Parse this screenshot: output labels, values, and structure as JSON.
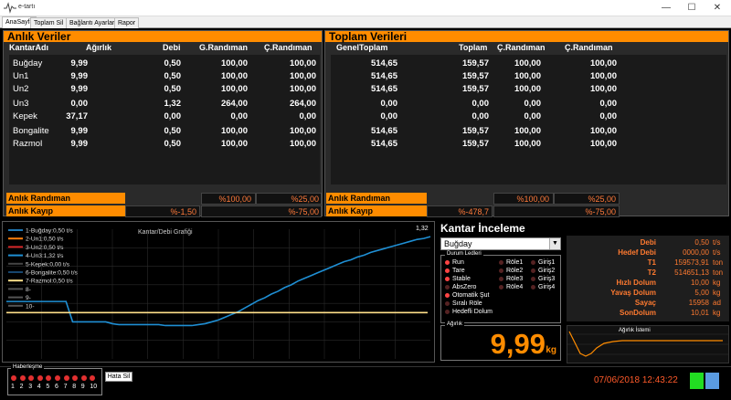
{
  "window": {
    "title": "e-tartı",
    "minimize": "—",
    "maximize": "☐",
    "close": "✕"
  },
  "tabs": [
    "AnaSayfa",
    "Toplam Sil",
    "Bağlantı Ayarları",
    "Rapor"
  ],
  "anlik": {
    "title": "Anlık Veriler",
    "headers": [
      "KantarAdı",
      "Ağırlık",
      "Debi",
      "G.Randıman",
      "Ç.Randıman"
    ],
    "rows": [
      [
        "Buğday",
        "9,99",
        "0,50",
        "100,00",
        "100,00"
      ],
      [
        "Un1",
        "9,99",
        "0,50",
        "100,00",
        "100,00"
      ],
      [
        "Un2",
        "9,99",
        "0,50",
        "100,00",
        "100,00"
      ],
      [
        "Un3",
        "0,00",
        "1,32",
        "264,00",
        "264,00"
      ],
      [
        "Kepek",
        "37,17",
        "0,00",
        "0,00",
        "0,00"
      ],
      [
        "Bongalite",
        "9,99",
        "0,50",
        "100,00",
        "100,00"
      ],
      [
        "Razmol",
        "9,99",
        "0,50",
        "100,00",
        "100,00"
      ]
    ],
    "randiman_label": "Anlık Randıman",
    "randiman_g": "%100,00",
    "randiman_c": "%25,00",
    "kayip_label": "Anlık Kayıp",
    "kayip_a": "%-1,50",
    "kayip_c": "%-75,00"
  },
  "toplam": {
    "title": "Toplam Verileri",
    "headers": [
      "GenelToplam",
      "Toplam",
      "Ç.Randıman",
      "Ç.Randıman"
    ],
    "rows": [
      [
        "514,65",
        "159,57",
        "100,00",
        "100,00"
      ],
      [
        "514,65",
        "159,57",
        "100,00",
        "100,00"
      ],
      [
        "514,65",
        "159,57",
        "100,00",
        "100,00"
      ],
      [
        "0,00",
        "0,00",
        "0,00",
        "0,00"
      ],
      [
        "0,00",
        "0,00",
        "0,00",
        "0,00"
      ],
      [
        "514,65",
        "159,57",
        "100,00",
        "100,00"
      ],
      [
        "514,65",
        "159,57",
        "100,00",
        "100,00"
      ]
    ],
    "randiman_label": "Anlık Randıman",
    "randiman_g": "%100,00",
    "randiman_c": "%25,00",
    "kayip_label": "Anlık Kayıp",
    "kayip_a": "%-478,7",
    "kayip_c": "%-75,00"
  },
  "chart_data": {
    "type": "line",
    "title": "Kantar/Debi Grafiği",
    "end_label": "1,32",
    "legend_placement": "top-left",
    "grid": true,
    "series": [
      {
        "name": "1-Buğday:0,50 t/s",
        "color": "#1f77b4"
      },
      {
        "name": "2-Un1:0,50 t/s",
        "color": "#ff7f0e"
      },
      {
        "name": "3-Un2:0,50 t/s",
        "color": "#d62728"
      },
      {
        "name": "4-Un3:1,32 t/s",
        "color": "#1f8fd4",
        "values": [
          0.62,
          0.62,
          0.62,
          0.62,
          0.62,
          0.62,
          0.62,
          0.62,
          0.62,
          0.62,
          0.4,
          0.4,
          0.4,
          0.4,
          0.4,
          0.4,
          0.38,
          0.37,
          0.37,
          0.37,
          0.37,
          0.37,
          0.37,
          0.37,
          0.36,
          0.36,
          0.36,
          0.36,
          0.36,
          0.37,
          0.38,
          0.4,
          0.42,
          0.45,
          0.48,
          0.51,
          0.55,
          0.59,
          0.63,
          0.66,
          0.7,
          0.73,
          0.77,
          0.8,
          0.84,
          0.87,
          0.9,
          0.93,
          0.96,
          0.99,
          1.02,
          1.05,
          1.07,
          1.1,
          1.12,
          1.15,
          1.17,
          1.19,
          1.21,
          1.23,
          1.25,
          1.27,
          1.29,
          1.3,
          1.32
        ]
      },
      {
        "name": "5-Kepek:0,00 t/s",
        "color": "#000000"
      },
      {
        "name": "6-Bongalite:0,50 t/s",
        "color": "#17466e"
      },
      {
        "name": "7-Razmol:0,50 t/s",
        "color": "#ffe08a",
        "values": [
          0.5,
          0.5,
          0.5,
          0.5,
          0.5,
          0.5,
          0.5,
          0.5,
          0.5,
          0.5,
          0.5,
          0.5,
          0.5,
          0.5,
          0.5,
          0.5,
          0.5,
          0.5,
          0.5,
          0.5
        ]
      },
      {
        "name": "8-",
        "color": "#555555"
      },
      {
        "name": "9-",
        "color": "#555555"
      },
      {
        "name": "10-",
        "color": "#555555"
      }
    ]
  },
  "kantar": {
    "title": "Kantar İnceleme",
    "selected": "Buğday",
    "durum_title": "Durum Ledleri",
    "leds_left": [
      {
        "label": "Run",
        "color": "#ff4444"
      },
      {
        "label": "Tare",
        "color": "#ff4444"
      },
      {
        "label": "Stable",
        "color": "#ff4444"
      },
      {
        "label": "AbsZero",
        "color": "#552222"
      },
      {
        "label": "Otomatik Şut",
        "color": "#ff4444"
      },
      {
        "label": "Sıralı Röle",
        "color": "#552222"
      },
      {
        "label": "Hedefli Dolum",
        "color": "#552222"
      }
    ],
    "leds_mid": [
      {
        "label": "Röle1",
        "color": "#552222"
      },
      {
        "label": "Röle2",
        "color": "#552222"
      },
      {
        "label": "Röle3",
        "color": "#552222"
      },
      {
        "label": "Röle4",
        "color": "#552222"
      }
    ],
    "leds_right": [
      {
        "label": "Giriş1",
        "color": "#552222"
      },
      {
        "label": "Giriş2",
        "color": "#552222"
      },
      {
        "label": "Giriş3",
        "color": "#552222"
      },
      {
        "label": "Giriş4",
        "color": "#552222"
      }
    ],
    "agirlik_title": "Ağırlık",
    "agirlik_value": "9,99",
    "agirlik_unit": "kg"
  },
  "stats": [
    {
      "label": "Debi",
      "value": "0,50",
      "unit": "t/s"
    },
    {
      "label": "Hedef Debi",
      "value": "0000,00",
      "unit": "t/s"
    },
    {
      "label": "T1",
      "value": "159573,91",
      "unit": "ton"
    },
    {
      "label": "T2",
      "value": "514651,13",
      "unit": "ton"
    },
    {
      "label": "Hızlı Dolum",
      "value": "10,00",
      "unit": "kg"
    },
    {
      "label": "Yavaş Dolum",
      "value": "5,00",
      "unit": "kg"
    },
    {
      "label": "Sayaç",
      "value": "15958",
      "unit": "ad"
    },
    {
      "label": "SonDolum",
      "value": "10,01",
      "unit": "kg"
    }
  ],
  "mini_chart": {
    "title": "Ağırlık İstemi"
  },
  "haberlesme": {
    "title": "Haberleşme",
    "numbers": [
      "1",
      "2",
      "3",
      "4",
      "5",
      "6",
      "7",
      "8",
      "9",
      "10"
    ]
  },
  "hata_sil": "Hata Sil",
  "datetime": "07/06/2018 12:43:22"
}
